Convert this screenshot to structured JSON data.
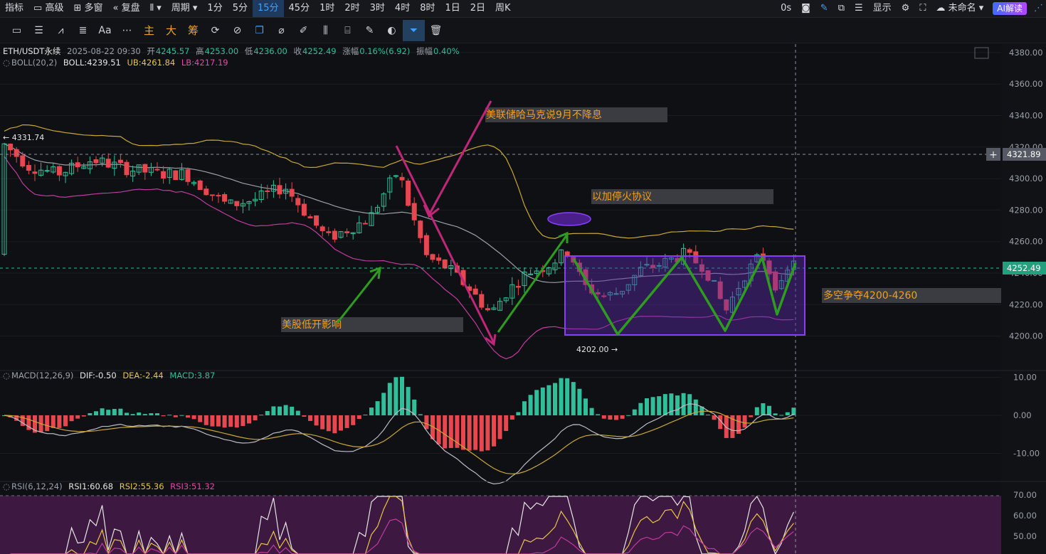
{
  "topbar": {
    "items": [
      "指标",
      "高级",
      "多窗",
      "复盘",
      "周期",
      "1分",
      "5分",
      "15分",
      "45分",
      "1时",
      "2时",
      "3时",
      "4时",
      "8时",
      "1日",
      "2日",
      "周K"
    ],
    "active": "15分",
    "right": {
      "timer": "0s",
      "display": "显示",
      "layout_name": "未命名",
      "ai_button": "AI解读"
    }
  },
  "toolbar": {
    "tools": [
      "rect-icon",
      "lines-icon",
      "indicator-icon",
      "list-icon",
      "font-icon",
      "more-icon",
      "主",
      "大",
      "筹",
      "refresh-icon",
      "brush-icon",
      "copy-icon",
      "ruler-icon",
      "pen-icon",
      "compare-icon",
      "clipboard-icon",
      "edit-icon",
      "eraser-icon",
      "filter-icon",
      "trash-icon"
    ]
  },
  "info_bar": {
    "symbol": "ETH/USDT永续",
    "datetime": "2025-08-22 09:30",
    "open_label": "开",
    "open": "4245.57",
    "high_label": "高",
    "high": "4253.00",
    "low_label": "低",
    "low": "4236.00",
    "close_label": "收",
    "close": "4252.49",
    "change_label": "涨幅",
    "change": "0.16%(6.92)",
    "amp_label": "振幅",
    "amp": "0.40%"
  },
  "boll": {
    "label": "BOLL(20,2)",
    "boll": "BOLL:4239.51",
    "ub": "UB:4261.84",
    "lb": "LB:4217.19"
  },
  "macd": {
    "label": "MACD(12,26,9)",
    "dif": "DIF:-0.50",
    "dea": "DEA:-2.44",
    "macd": "MACD:3.87"
  },
  "rsi": {
    "label": "RSI(6,12,24)",
    "rsi1": "RSI1:60.68",
    "rsi2": "RSI2:55.36",
    "rsi3": "RSI3:51.32"
  },
  "price_axis": [
    "4380.00",
    "4360.00",
    "4340.00",
    "4320.00",
    "4300.00",
    "4280.00",
    "4260.00",
    "4240.00",
    "4220.00",
    "4200.00"
  ],
  "crosshair_price": "4321.89",
  "last_price": "4252.49",
  "high_marker": "4331.74",
  "low_marker": "4202.00",
  "macd_axis": [
    "10.00",
    "0.00",
    "-10.00"
  ],
  "rsi_axis": [
    "70.00",
    "60.00",
    "50.00"
  ],
  "annotations": {
    "fed": "美联储哈马克说9月不降息",
    "ceasefire": "以加停火协议",
    "stocks": "美股低开影响",
    "range": "多空争夺4200-4260"
  },
  "colors": {
    "up": "#2fbf9a",
    "down": "#e8474f",
    "accent": "#3fa0ff",
    "boll_ub": "#c9a832",
    "boll_lb": "#c23aa0",
    "box": "#7d3cff"
  }
}
